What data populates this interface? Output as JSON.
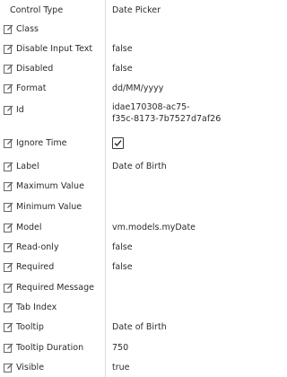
{
  "header": {
    "name": "Control Type",
    "value": "Date Picker"
  },
  "properties": [
    {
      "name": "Class",
      "value": ""
    },
    {
      "name": "Disable Input Text",
      "value": "false"
    },
    {
      "name": "Disabled",
      "value": "false"
    },
    {
      "name": "Format",
      "value": "dd/MM/yyyy"
    },
    {
      "name": "Id",
      "value_lines": [
        "idae170308-ac75-",
        "f35c-8173-7b7527d7af26"
      ]
    },
    {
      "name": "Ignore Time",
      "checked": true
    },
    {
      "name": "Label",
      "value": "Date of Birth"
    },
    {
      "name": "Maximum Value",
      "value": ""
    },
    {
      "name": "Minimum Value",
      "value": ""
    },
    {
      "name": "Model",
      "value": "vm.models.myDate"
    },
    {
      "name": "Read-only",
      "value": "false"
    },
    {
      "name": "Required",
      "value": "false"
    },
    {
      "name": "Required Message",
      "value": ""
    },
    {
      "name": "Tab Index",
      "value": ""
    },
    {
      "name": "Tooltip",
      "value": "Date of Birth"
    },
    {
      "name": "Tooltip Duration",
      "value": "750"
    },
    {
      "name": "Visible",
      "value": "true"
    }
  ],
  "icons": {
    "property_icon": "edit-icon",
    "checkbox_icon": "checkmark-icon"
  }
}
